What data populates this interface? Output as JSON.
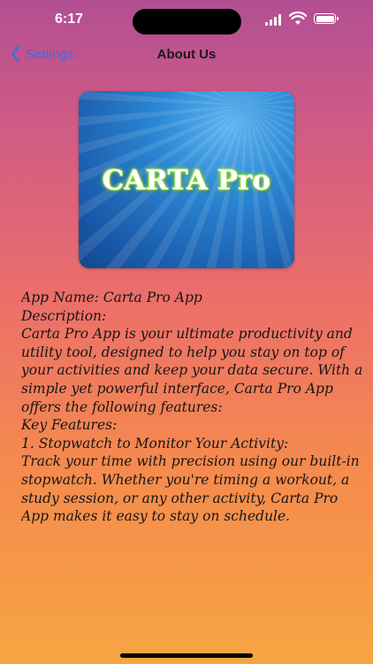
{
  "status_bar": {
    "time": "6:17"
  },
  "nav": {
    "back_label": "Settings",
    "title": "About Us"
  },
  "logo": {
    "text": "CARTA Pro"
  },
  "about": {
    "app_name_line": "App Name: Carta Pro App",
    "description_heading": "Description:",
    "description": "Carta Pro App is your ultimate productivity and utility tool, designed to help you stay on top of your activities and keep your data secure. With a simple yet powerful interface, Carta Pro App offers the following features:",
    "key_features_heading": "Key Features:",
    "feature_1_title": "1. Stopwatch to Monitor Your Activity:",
    "feature_1_text": "Track your time with precision using our built-in stopwatch. Whether you're timing a workout, a study session, or any other activity, Carta Pro App makes it easy to stay on schedule."
  }
}
